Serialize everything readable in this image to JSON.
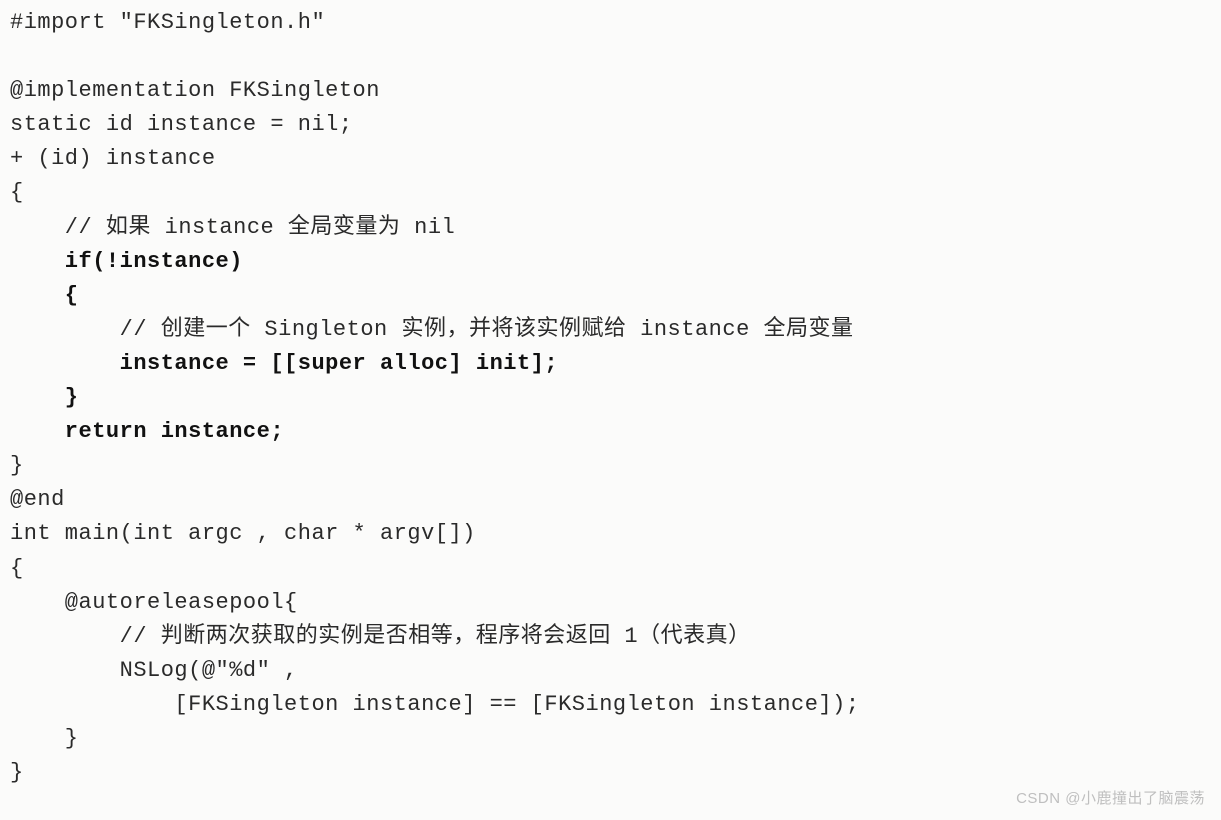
{
  "code": {
    "l01": "#import \"FKSingleton.h\"",
    "l02": "",
    "l03": "@implementation FKSingleton",
    "l04": "static id instance = nil;",
    "l05": "+ (id) instance",
    "l06": "{",
    "l07": "    // 如果 instance 全局变量为 nil",
    "l08": "    if(!instance)",
    "l09": "    {",
    "l10": "        // 创建一个 Singleton 实例，并将该实例赋给 instance 全局变量",
    "l11": "        instance = [[super alloc] init];",
    "l12": "    }",
    "l13": "    return instance;",
    "l14": "}",
    "l15": "@end",
    "l16": "int main(int argc , char * argv[])",
    "l17": "{",
    "l18": "    @autoreleasepool{",
    "l19": "        // 判断两次获取的实例是否相等，程序将会返回 1（代表真）",
    "l20": "        NSLog(@\"%d\" ,",
    "l21": "            [FKSingleton instance] == [FKSingleton instance]);",
    "l22": "    }",
    "l23": "}"
  },
  "watermark": "CSDN @小鹿撞出了脑震荡"
}
